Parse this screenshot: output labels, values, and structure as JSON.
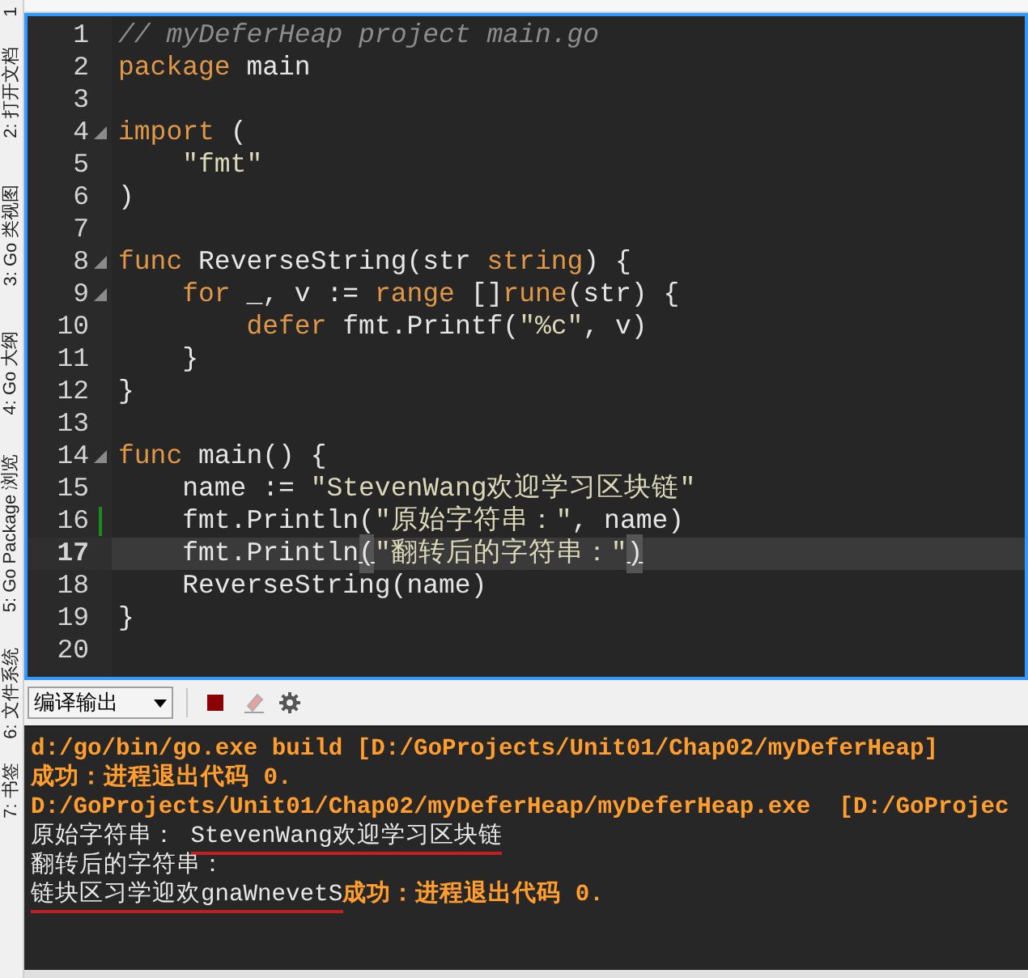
{
  "side_tabs": [
    {
      "label": "1"
    },
    {
      "label": "2: 打开文档"
    },
    {
      "label": "3: Go 类视图"
    },
    {
      "label": "4: Go 大纲"
    },
    {
      "label": "5: Go Package 浏览"
    },
    {
      "label": "6: 文件系统"
    },
    {
      "label": "7: 书签"
    }
  ],
  "editor": {
    "lines": [
      {
        "number": "1",
        "fold": false,
        "current": false,
        "changed": false,
        "tokens": [
          {
            "kind": "comment",
            "text": "// myDeferHeap project main.go"
          }
        ]
      },
      {
        "number": "2",
        "fold": false,
        "current": false,
        "changed": false,
        "tokens": [
          {
            "kind": "keyword",
            "text": "package"
          },
          {
            "kind": "plain",
            "text": " main"
          }
        ]
      },
      {
        "number": "3",
        "fold": false,
        "current": false,
        "changed": false
      },
      {
        "number": "4",
        "fold": true,
        "current": false,
        "changed": false,
        "tokens": [
          {
            "kind": "keyword",
            "text": "import"
          },
          {
            "kind": "plain",
            "text": " ("
          }
        ]
      },
      {
        "number": "5",
        "fold": false,
        "current": false,
        "changed": false,
        "tokens": [
          {
            "kind": "string",
            "text": "    \"fmt\""
          }
        ]
      },
      {
        "number": "6",
        "fold": false,
        "current": false,
        "changed": false,
        "tokens": [
          {
            "kind": "plain",
            "text": ")"
          }
        ]
      },
      {
        "number": "7",
        "fold": false,
        "current": false,
        "changed": false
      },
      {
        "number": "8",
        "fold": true,
        "current": false,
        "changed": false,
        "tokens": [
          {
            "kind": "keyword",
            "text": "func"
          },
          {
            "kind": "plain",
            "text": " ReverseString(str "
          },
          {
            "kind": "keyword",
            "text": "string"
          },
          {
            "kind": "plain",
            "text": ") {"
          }
        ]
      },
      {
        "number": "9",
        "fold": true,
        "current": false,
        "changed": false,
        "tokens": [
          {
            "kind": "keyword",
            "text": "    for"
          },
          {
            "kind": "plain",
            "text": " _, v := "
          },
          {
            "kind": "keyword",
            "text": "range"
          },
          {
            "kind": "plain",
            "text": " []"
          },
          {
            "kind": "keyword",
            "text": "rune"
          },
          {
            "kind": "plain",
            "text": "(str) {"
          }
        ]
      },
      {
        "number": "10",
        "fold": false,
        "current": false,
        "changed": false,
        "tokens": [
          {
            "kind": "keyword",
            "text": "        defer"
          },
          {
            "kind": "plain",
            "text": " fmt.Printf("
          },
          {
            "kind": "string",
            "text": "\"%c\""
          },
          {
            "kind": "plain",
            "text": ", v)"
          }
        ]
      },
      {
        "number": "11",
        "fold": false,
        "current": false,
        "changed": false,
        "tokens": [
          {
            "kind": "plain",
            "text": "    }"
          }
        ]
      },
      {
        "number": "12",
        "fold": false,
        "current": false,
        "changed": false,
        "tokens": [
          {
            "kind": "plain",
            "text": "}"
          }
        ]
      },
      {
        "number": "13",
        "fold": false,
        "current": false,
        "changed": false
      },
      {
        "number": "14",
        "fold": true,
        "current": false,
        "changed": false,
        "tokens": [
          {
            "kind": "keyword",
            "text": "func"
          },
          {
            "kind": "plain",
            "text": " main() {"
          }
        ]
      },
      {
        "number": "15",
        "fold": false,
        "current": false,
        "changed": false,
        "tokens": [
          {
            "kind": "plain",
            "text": "    name := "
          },
          {
            "kind": "string",
            "text": "\"StevenWang欢迎学习区块链\""
          }
        ]
      },
      {
        "number": "16",
        "fold": false,
        "current": false,
        "changed": true,
        "tokens": [
          {
            "kind": "plain",
            "text": "    fmt.Println("
          },
          {
            "kind": "string",
            "text": "\"原始字符串：\""
          },
          {
            "kind": "plain",
            "text": ", name)"
          }
        ]
      },
      {
        "number": "17",
        "fold": false,
        "current": true,
        "changed": false,
        "tokens": [
          {
            "kind": "plain",
            "text": "    fmt.Println"
          },
          {
            "kind": "bracket",
            "text": "("
          },
          {
            "kind": "string",
            "text": "\"翻转后的字符串：\""
          },
          {
            "kind": "bracket",
            "text": ")"
          }
        ]
      },
      {
        "number": "18",
        "fold": false,
        "current": false,
        "changed": false,
        "tokens": [
          {
            "kind": "plain",
            "text": "    ReverseString(name)"
          }
        ]
      },
      {
        "number": "19",
        "fold": false,
        "current": false,
        "changed": false,
        "tokens": [
          {
            "kind": "plain",
            "text": "}"
          }
        ]
      },
      {
        "number": "20",
        "fold": false,
        "current": false,
        "changed": false
      }
    ]
  },
  "output_toolbar": {
    "dropdown": {
      "value": "编译输出"
    }
  },
  "output": {
    "lines": [
      [
        {
          "kind": "status",
          "text": "d:/go/bin/go.exe build [D:/GoProjects/Unit01/Chap02/myDeferHeap]",
          "underlined": false
        }
      ],
      [
        {
          "kind": "status",
          "text": "成功：进程退出代码 0.",
          "underlined": false
        }
      ],
      [
        {
          "kind": "status",
          "text": "D:/GoProjects/Unit01/Chap02/myDeferHeap/myDeferHeap.exe  [D:/GoProjec",
          "underlined": false
        }
      ],
      [
        {
          "kind": "program",
          "text": "原始字符串： ",
          "underlined": false
        },
        {
          "kind": "program",
          "text": "StevenWang欢迎学习区块链",
          "underlined": true
        }
      ],
      [
        {
          "kind": "program",
          "text": "翻转后的字符串：",
          "underlined": false
        }
      ],
      [
        {
          "kind": "program",
          "text": "链块区习学迎欢gnaWnevetS",
          "underlined": true
        },
        {
          "kind": "status",
          "text": "成功：进程退出代码 0.",
          "underlined": false
        }
      ]
    ]
  }
}
